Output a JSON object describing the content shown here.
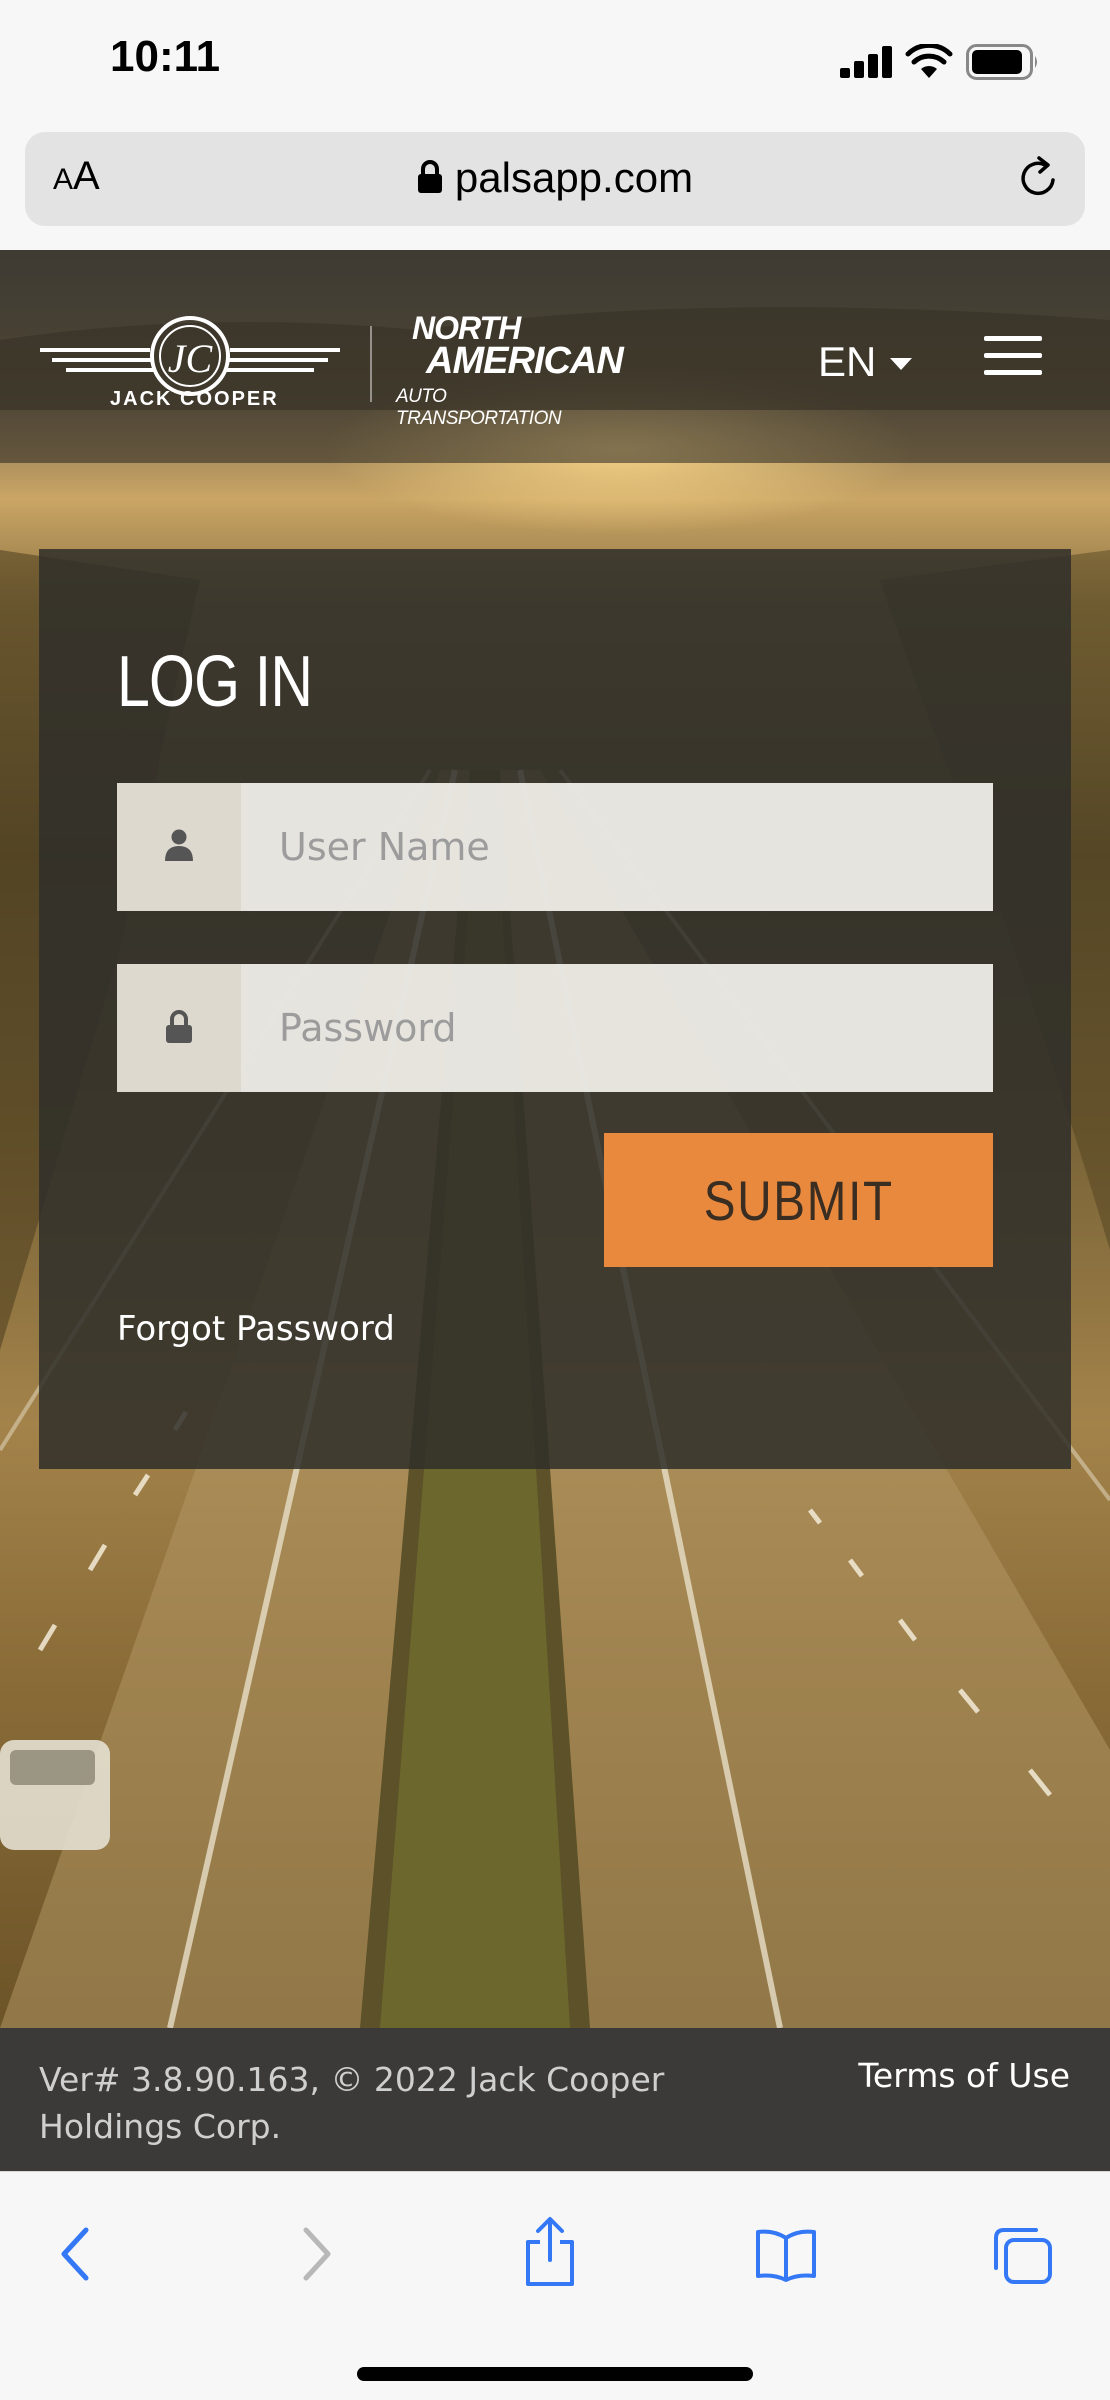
{
  "status_bar": {
    "time": "10:11"
  },
  "browser": {
    "text_size_label": "AA",
    "url": "palsapp.com"
  },
  "header": {
    "brand1_label": "JACK COOPER",
    "brand2_line1": "NORTH",
    "brand2_line2": "AMERICAN",
    "brand2_line3": "AUTO TRANSPORTATION",
    "language": "EN"
  },
  "login": {
    "title": "LOG IN",
    "username_placeholder": "User Name",
    "password_placeholder": "Password",
    "submit_label": "SUBMIT",
    "forgot_label": "Forgot Password"
  },
  "footer": {
    "version_text": "Ver# 3.8.90.163, © 2022 Jack Cooper Holdings Corp.",
    "terms_label": "Terms of Use"
  },
  "colors": {
    "accent": "#e8893e",
    "panel": "#302e2a",
    "footer": "#3b3a38",
    "ios_blue": "#3478f6"
  },
  "icons": {
    "toolbar": [
      "back-icon",
      "forward-icon",
      "share-icon",
      "bookmarks-icon",
      "tabs-icon"
    ]
  }
}
